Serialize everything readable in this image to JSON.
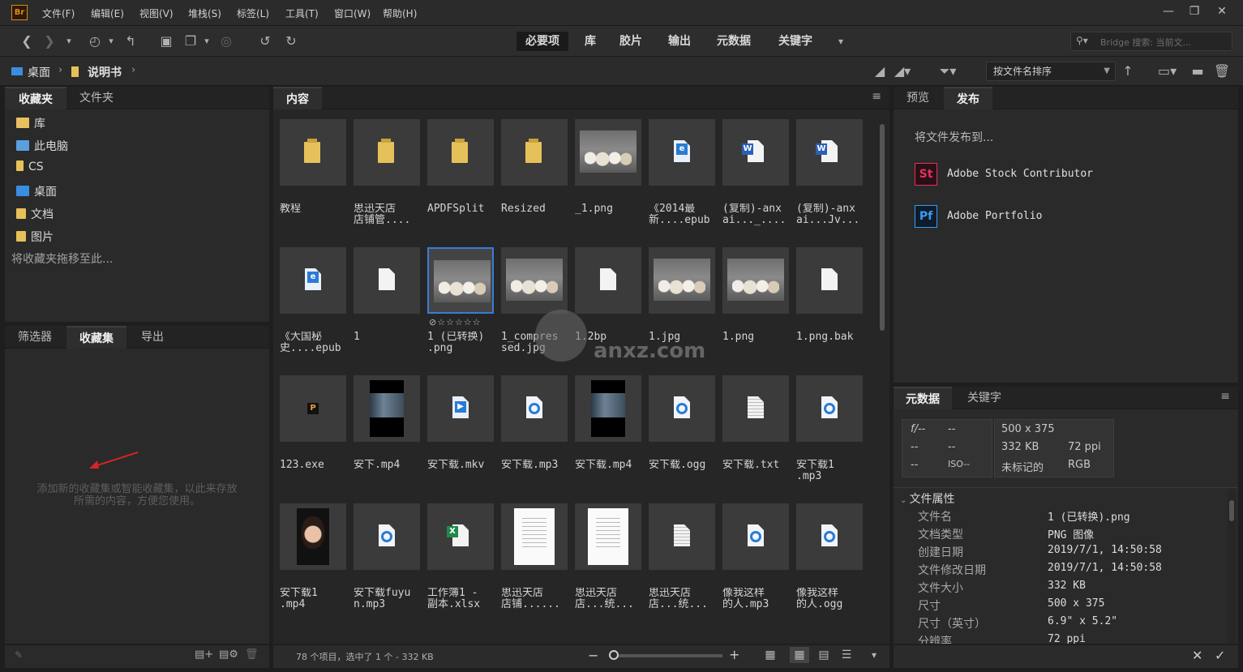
{
  "app": {
    "logo": "Br"
  },
  "menu": [
    "文件(F)",
    "编辑(E)",
    "视图(V)",
    "堆栈(S)",
    "标签(L)",
    "工具(T)",
    "窗口(W)",
    "帮助(H)"
  ],
  "window_controls": {
    "minimize": "—",
    "restore": "❐",
    "close": "✕"
  },
  "workspaces": [
    "必要项",
    "库",
    "胶片",
    "输出",
    "元数据",
    "关键字"
  ],
  "search": {
    "placeholder": "Bridge 搜索: 当前文..."
  },
  "breadcrumb": [
    "桌面",
    "说明书"
  ],
  "sort": {
    "selected": "按文件名排序"
  },
  "left_panel": {
    "tabs": [
      "收藏夹",
      "文件夹"
    ],
    "favorites": [
      {
        "label": "库",
        "icon": "library-icon",
        "color": "#e8c060"
      },
      {
        "label": "此电脑",
        "icon": "computer-icon",
        "color": "#5aa0e0"
      },
      {
        "label": "CS",
        "icon": "folder-icon",
        "color": "#e6c15a"
      },
      {
        "label": "桌面",
        "icon": "desktop-icon",
        "color": "#3a8ee0"
      },
      {
        "label": "文档",
        "icon": "documents-icon",
        "color": "#e6c15a"
      },
      {
        "label": "图片",
        "icon": "pictures-icon",
        "color": "#e6c15a"
      }
    ],
    "drag_hint": "将收藏夹拖移至此...",
    "lower_tabs": [
      "筛选器",
      "收藏集",
      "导出"
    ],
    "collections_hint_1": "添加新的收藏集或智能收藏集，以此来存放",
    "collections_hint_2": "所需的内容，方便您使用。"
  },
  "content": {
    "tab": "内容",
    "items": [
      {
        "label": "教程",
        "kind": "folder"
      },
      {
        "label": "思迅天店\n店铺管....",
        "kind": "folder"
      },
      {
        "label": "APDFSplit",
        "kind": "folder"
      },
      {
        "label": "Resized",
        "kind": "folder"
      },
      {
        "label": "_1.png",
        "kind": "photo"
      },
      {
        "label": "《2014最\n新....epub",
        "kind": "epub"
      },
      {
        "label": "(复制)-anx\nai..._....",
        "kind": "word"
      },
      {
        "label": "(复制)-anx\nai...Jv...",
        "kind": "word"
      },
      {
        "label": "《大国秘\n史....epub",
        "kind": "epub"
      },
      {
        "label": "1",
        "kind": "doc"
      },
      {
        "label": "1 (已转换)\n.png",
        "kind": "photo",
        "selected": true,
        "rating": "⊘☆☆☆☆☆"
      },
      {
        "label": "1_compres\nsed.jpg",
        "kind": "photo"
      },
      {
        "label": "1.2bp",
        "kind": "doc"
      },
      {
        "label": "1.jpg",
        "kind": "photo"
      },
      {
        "label": "1.png",
        "kind": "photo"
      },
      {
        "label": "1.png.bak",
        "kind": "doc"
      },
      {
        "label": "123.exe",
        "kind": "exe"
      },
      {
        "label": "安下.mp4",
        "kind": "video"
      },
      {
        "label": "安下载.mkv",
        "kind": "mkv"
      },
      {
        "label": "安下载.mp3",
        "kind": "audio"
      },
      {
        "label": "安下载.mp4",
        "kind": "video"
      },
      {
        "label": "安下载.ogg",
        "kind": "audio"
      },
      {
        "label": "安下载.txt",
        "kind": "txt"
      },
      {
        "label": "安下载1\n.mp3",
        "kind": "audio"
      },
      {
        "label": "安下载1\n.mp4",
        "kind": "portrait"
      },
      {
        "label": "安下载fuyu\nn.mp3",
        "kind": "audio"
      },
      {
        "label": "工作簿1 -\n副本.xlsx",
        "kind": "excel"
      },
      {
        "label": "思迅天店\n店铺......",
        "kind": "page"
      },
      {
        "label": "思迅天店\n店...统...",
        "kind": "page"
      },
      {
        "label": "思迅天店\n店...统...",
        "kind": "txt"
      },
      {
        "label": "像我这样\n的人.mp3",
        "kind": "audio"
      },
      {
        "label": "像我这样\n的人.ogg",
        "kind": "audio"
      }
    ],
    "status": "78 个项目，选中了 1 个 - 332 KB"
  },
  "right_panel": {
    "tabs": [
      "预览",
      "发布"
    ],
    "publish_title": "将文件发布到...",
    "publish_targets": [
      {
        "badge": "St",
        "label": "Adobe Stock Contributor",
        "color": "#e0325a"
      },
      {
        "badge": "Pf",
        "label": "Adobe Portfolio",
        "color": "#3a9af0"
      }
    ],
    "meta_tabs": [
      "元数据",
      "关键字"
    ],
    "camera": {
      "f": "f/--",
      "c1": "--",
      "c2": "--",
      "c3": "--",
      "c4": "--",
      "iso": "ISO--"
    },
    "summary": {
      "dims": "500 x 375",
      "size": "332 KB",
      "ppi": "72 ppi",
      "label": "未标记的",
      "mode": "RGB"
    },
    "section": "文件属性",
    "properties": [
      {
        "key": "文件名",
        "value": "1 (已转换).png"
      },
      {
        "key": "文档类型",
        "value": "PNG 图像"
      },
      {
        "key": "创建日期",
        "value": "2019/7/1, 14:50:58"
      },
      {
        "key": "文件修改日期",
        "value": "2019/7/1, 14:50:58"
      },
      {
        "key": "文件大小",
        "value": "332 KB"
      },
      {
        "key": "尺寸",
        "value": "500 x 375"
      },
      {
        "key": "尺寸（英寸）",
        "value": "6.9\" x 5.2\""
      },
      {
        "key": "分辨率",
        "value": "72 ppi"
      }
    ]
  },
  "watermark": "anxz.com",
  "colors": {
    "accent": "#3b7bd6",
    "bg": "#2a2a2a",
    "selection": "#3b7bd6"
  }
}
